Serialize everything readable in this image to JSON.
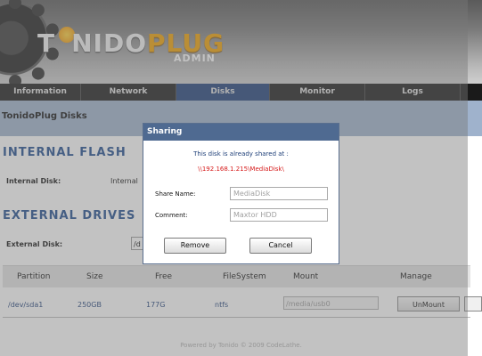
{
  "header": {
    "logo_text_white_1": "T",
    "logo_text_white_2": "NIDO",
    "logo_text_orange": "PLUG",
    "admin_label": "ADMIN"
  },
  "nav": {
    "tabs": [
      {
        "label": "Information",
        "active": false
      },
      {
        "label": "Network",
        "active": false
      },
      {
        "label": "Disks",
        "active": true
      },
      {
        "label": "Monitor",
        "active": false
      },
      {
        "label": "Logs",
        "active": false
      }
    ]
  },
  "page_title": "TonidoPlug Disks",
  "internal": {
    "heading": "INTERNAL FLASH",
    "disk_label": "Internal Disk:",
    "disk_value": "Internal"
  },
  "external": {
    "heading": "EXTERNAL DRIVES",
    "disk_label": "External Disk:",
    "select_value": "/d"
  },
  "table": {
    "headers": [
      "Partition",
      "Size",
      "Free",
      "FileSystem",
      "Mount",
      "Manage"
    ],
    "rows": [
      {
        "partition": "/dev/sda1",
        "size": "250GB",
        "free": "177G",
        "filesystem": "ntfs",
        "mount": "/media/usb0",
        "action": "UnMount"
      }
    ]
  },
  "footer": "Powered by Tonido © 2009 CodeLathe.",
  "dialog": {
    "title": "Sharing",
    "message": "This disk is already shared at :",
    "share_path": "\\\\192.168.1.215\\MediaDisk\\",
    "share_name_label": "Share Name:",
    "share_name_value": "MediaDisk",
    "comment_label": "Comment:",
    "comment_value": "Maxtor HDD",
    "remove_label": "Remove",
    "cancel_label": "Cancel"
  },
  "colors": {
    "nav_active": "#1e3f78",
    "section_heading": "#1e4b8f",
    "dialog_title_bar": "#4f6a91",
    "share_path": "#d61a1a",
    "logo_orange": "#f0a000"
  }
}
